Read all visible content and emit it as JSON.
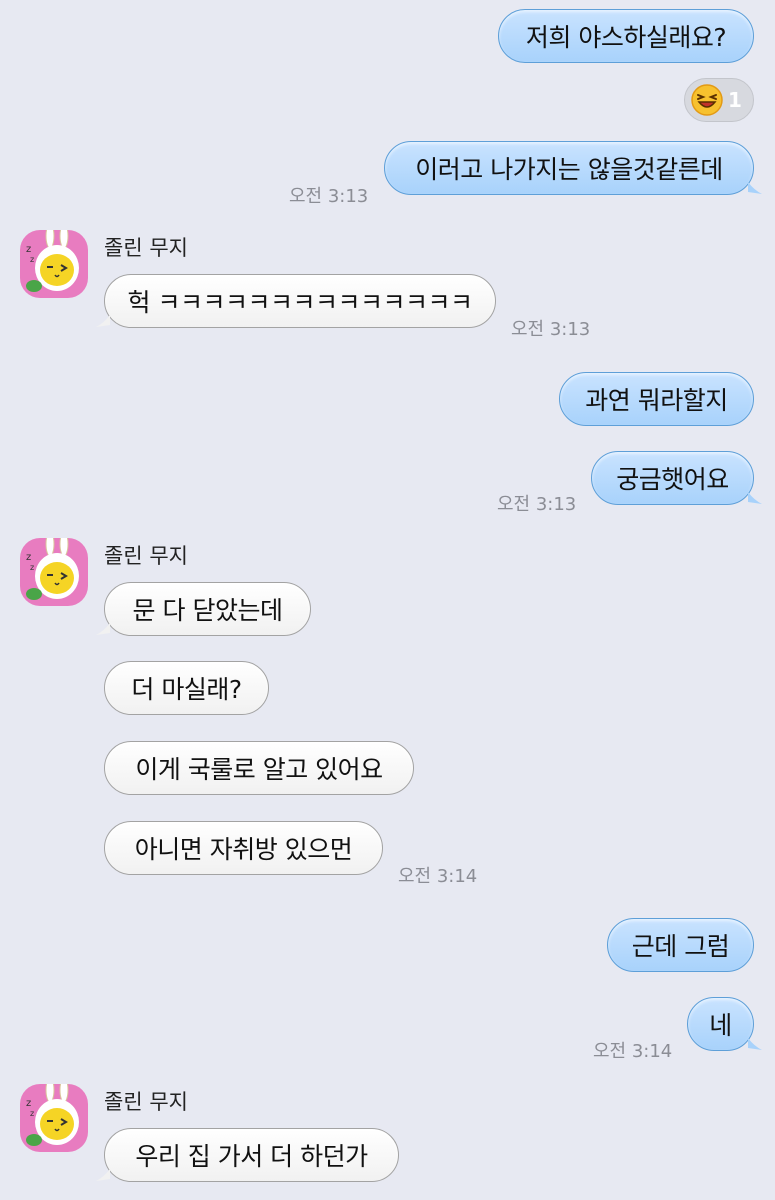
{
  "contact": {
    "name": "졸린 무지"
  },
  "messages": {
    "m1": "저희 야스하실래요?",
    "m1_reaction_count": "1",
    "m2": "이러고 나가지는 않을것같른데",
    "t1": "오전 3:13",
    "r1": "헉 ㅋㅋㅋㅋㅋㅋㅋㅋㅋㅋㅋㅋㅋㅋ",
    "t2": "오전 3:13",
    "m3": "과연 뭐라할지",
    "m4": "궁금햇어요",
    "t3": "오전 3:13",
    "r2": "문 다 닫았는데",
    "r3": "더 마실래?",
    "r4": "이게 국룰로 알고 있어요",
    "r5": "아니면 자취방 있으먼",
    "t4": "오전 3:14",
    "m5": "근데 그럼",
    "m6": "네",
    "t5": "오전 3:14",
    "r6": "우리 집 가서 더 하던가"
  },
  "icons": {
    "reaction": "grinning-squint-emoji-icon",
    "avatar": "muzi-character-icon"
  }
}
